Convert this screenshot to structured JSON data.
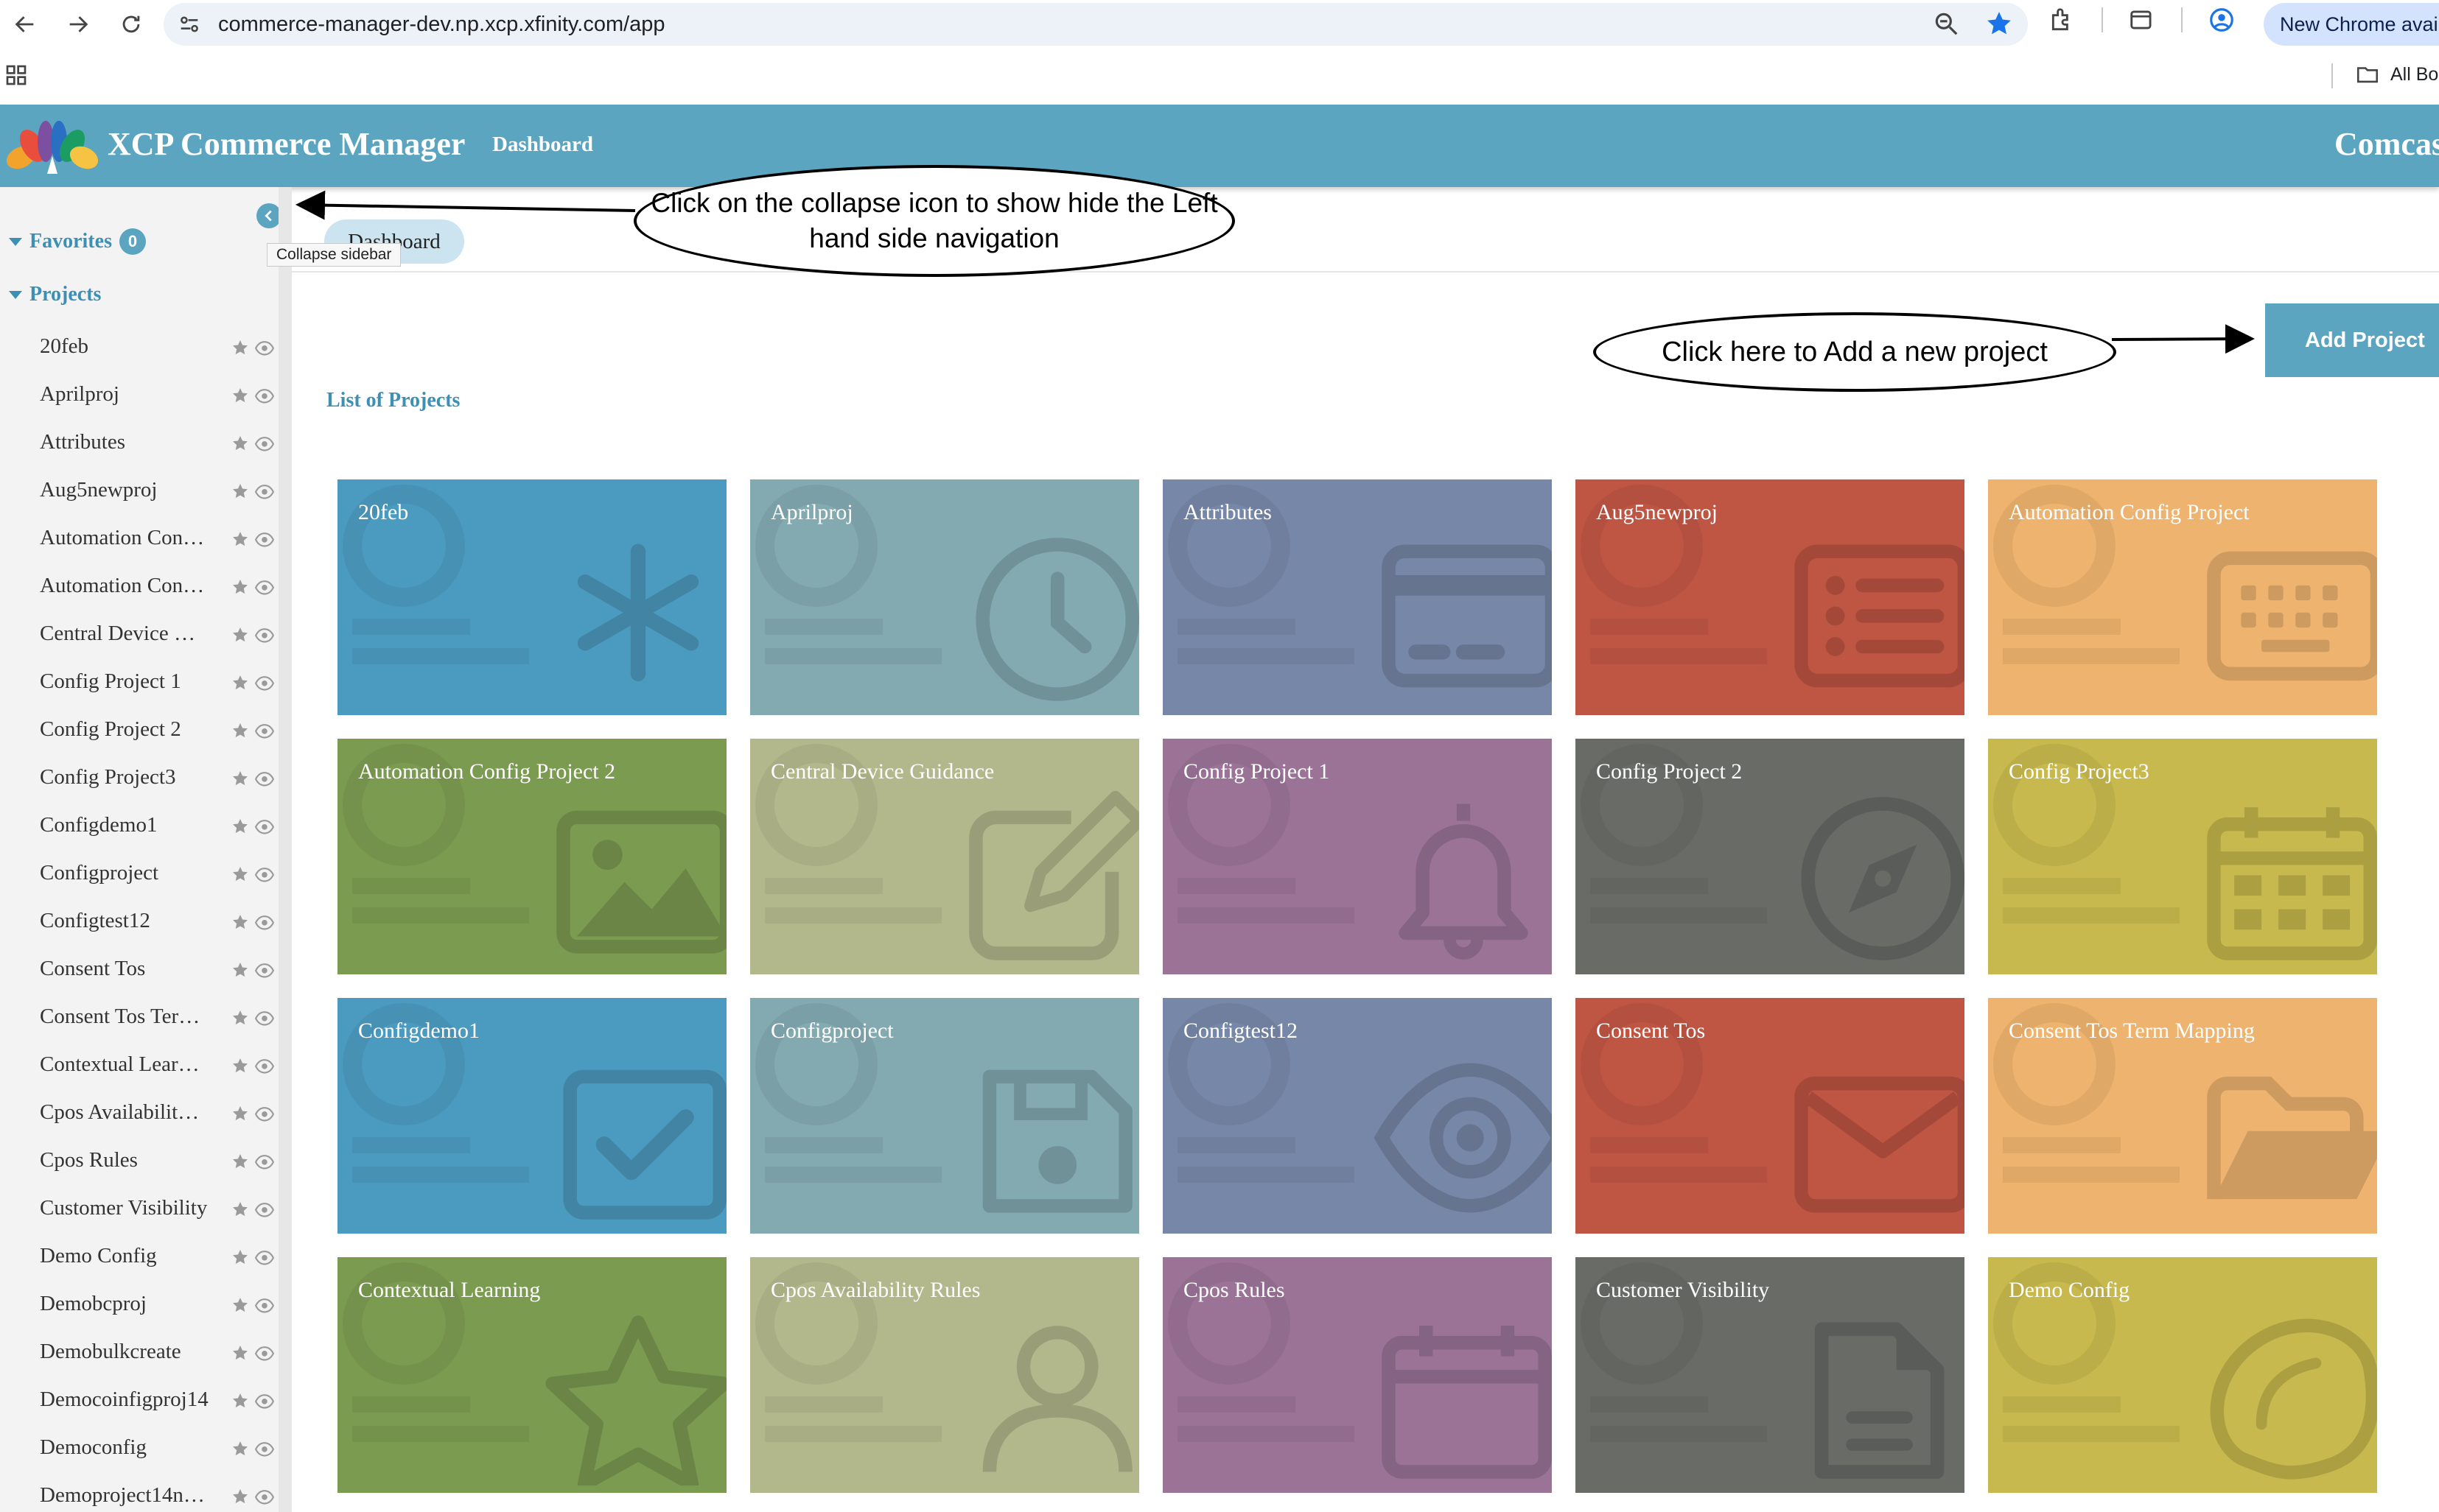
{
  "browser": {
    "url": "commerce-manager-dev.np.xcp.xfinity.com/app",
    "new_chrome_label": "New Chrome avai",
    "all_bookmarks_label": "All Bo"
  },
  "header": {
    "title": "XCP Commerce Manager",
    "dashboard_link": "Dashboard",
    "right_brand": "Comcas"
  },
  "sidebar": {
    "favorites_label": "Favorites",
    "favorites_count": "0",
    "projects_label": "Projects",
    "collapse_tooltip": "Collapse sidebar",
    "projects": [
      "20feb",
      "Aprilproj",
      "Attributes",
      "Aug5newproj",
      "Automation Con…",
      "Automation Con…",
      "Central Device …",
      "Config Project 1",
      "Config Project 2",
      "Config Project3",
      "Configdemo1",
      "Configproject",
      "Configtest12",
      "Consent Tos",
      "Consent Tos Ter…",
      "Contextual Lear…",
      "Cpos Availabilit…",
      "Cpos Rules",
      "Customer Visibility",
      "Demo Config",
      "Demobcproj",
      "Demobulkcreate",
      "Democoinfigproj14",
      "Democonfig",
      "Demoproject14n…"
    ]
  },
  "main": {
    "tab_label": "Dashboard",
    "list_title": "List of Projects",
    "add_project_label": "Add Project"
  },
  "annotations": {
    "collapse_note": "Click on the collapse icon to show hide the Left hand side navigation",
    "add_note": "Click here to Add a new project"
  },
  "tiles": [
    {
      "title": "20feb",
      "color": "#4b9abf",
      "icon": "asterisk-icon"
    },
    {
      "title": "Aprilproj",
      "color": "#83a9b1",
      "icon": "clock-icon"
    },
    {
      "title": "Attributes",
      "color": "#7787a8",
      "icon": "credit-card-icon"
    },
    {
      "title": "Aug5newproj",
      "color": "#bf5543",
      "icon": "list-icon"
    },
    {
      "title": "Automation Config Project",
      "color": "#eeb36e",
      "icon": "keyboard-icon"
    },
    {
      "title": "Automation Config Project 2",
      "color": "#7b9b50",
      "icon": "image-icon"
    },
    {
      "title": "Central Device Guidance",
      "color": "#b3b88c",
      "icon": "edit-icon"
    },
    {
      "title": "Config Project 1",
      "color": "#9b7397",
      "icon": "bell-icon"
    },
    {
      "title": "Config Project 2",
      "color": "#686b66",
      "icon": "compass-icon"
    },
    {
      "title": "Config Project3",
      "color": "#c7b94d",
      "icon": "calendar-icon"
    },
    {
      "title": "Configdemo1",
      "color": "#4b9abf",
      "icon": "check-square-icon"
    },
    {
      "title": "Configproject",
      "color": "#83a9b1",
      "icon": "floppy-disk-icon"
    },
    {
      "title": "Configtest12",
      "color": "#7787a8",
      "icon": "eye-icon"
    },
    {
      "title": "Consent Tos",
      "color": "#bf5543",
      "icon": "envelope-icon"
    },
    {
      "title": "Consent Tos Term Mapping",
      "color": "#eeb36e",
      "icon": "folder-open-icon"
    },
    {
      "title": "Contextual Learning",
      "color": "#7b9b50",
      "icon": "star-icon"
    },
    {
      "title": "Cpos Availability Rules",
      "color": "#b3b88c",
      "icon": "user-icon"
    },
    {
      "title": "Cpos Rules",
      "color": "#9b7397",
      "icon": "calendar-blank-icon"
    },
    {
      "title": "Customer Visibility",
      "color": "#686b66",
      "icon": "file-icon"
    },
    {
      "title": "Demo Config",
      "color": "#c7b94d",
      "icon": "lemon-icon"
    }
  ]
}
